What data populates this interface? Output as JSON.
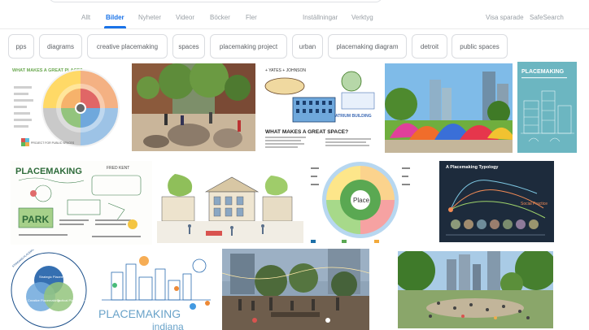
{
  "nav": {
    "tabs": [
      {
        "label": "Allt"
      },
      {
        "label": "Bilder"
      },
      {
        "label": "Nyheter"
      },
      {
        "label": "Videor"
      },
      {
        "label": "Böcker"
      },
      {
        "label": "Fler"
      },
      {
        "label": "Inställningar"
      },
      {
        "label": "Verktyg"
      }
    ],
    "active_tab": "Bilder",
    "saved_label": "Visa sparade",
    "safesearch_label": "SafeSearch"
  },
  "chips": [
    {
      "label": "pps"
    },
    {
      "label": "diagrams"
    },
    {
      "label": "creative placemaking"
    },
    {
      "label": "spaces"
    },
    {
      "label": "placemaking project"
    },
    {
      "label": "urban"
    },
    {
      "label": "placemaking diagram"
    },
    {
      "label": "detroit"
    },
    {
      "label": "public spaces"
    }
  ],
  "results": {
    "wheel": {
      "title": "WHAT MAKES A GREAT PLACE?",
      "brand": "PROJECT FOR PUBLIC SPACES"
    },
    "plaza_photo": {},
    "sketch_notes": {
      "header": "+ YATES + JOHNSON",
      "title": "WHAT MAKES A GREAT SPACE?",
      "tag": "ATRIUM BUILDING"
    },
    "pavilion_photo": {},
    "book": {
      "title": "PLACEMAKING"
    },
    "graphic_record": {
      "title": "PLACEMAKING",
      "author": "FRED KENT",
      "word": "PARK"
    },
    "street_sketch": {},
    "place_diagram": {
      "center": "Place"
    },
    "typology": {
      "title": "A Placemaking Typology",
      "label": "Social Practice"
    },
    "venn": {
      "side_text": "STANDARD PLACEMAKING",
      "a": "Strategic Placemaking",
      "b": "Creative Placemaking",
      "c": "Tactical Placemaking"
    },
    "indiana": {
      "word1": "PLACEMAKING",
      "word2": "indiana"
    },
    "night_plaza": {},
    "park_photo": {}
  },
  "colors": {
    "accent": "#1a73e8",
    "muted_text": "#9aa0a6",
    "chip_border": "#dadce0"
  }
}
